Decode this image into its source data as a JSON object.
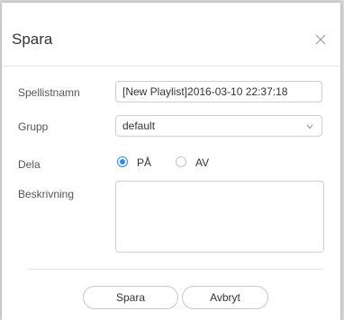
{
  "dialog": {
    "title": "Spara",
    "close_icon": "close-icon"
  },
  "form": {
    "playlist_name": {
      "label": "Spellistnamn",
      "value": "[New Playlist]2016-03-10 22:37:18"
    },
    "group": {
      "label": "Grupp",
      "selected": "default",
      "icon": "chevron-down-icon"
    },
    "share": {
      "label": "Dela",
      "options": [
        {
          "label": "PÅ",
          "checked": true
        },
        {
          "label": "AV",
          "checked": false
        }
      ]
    },
    "description": {
      "label": "Beskrivning",
      "value": ""
    }
  },
  "buttons": {
    "save_label": "Spara",
    "cancel_label": "Avbryt"
  },
  "colors": {
    "accent": "#2d8cf0",
    "border": "#cfcfcf",
    "background": "#ffffff"
  }
}
